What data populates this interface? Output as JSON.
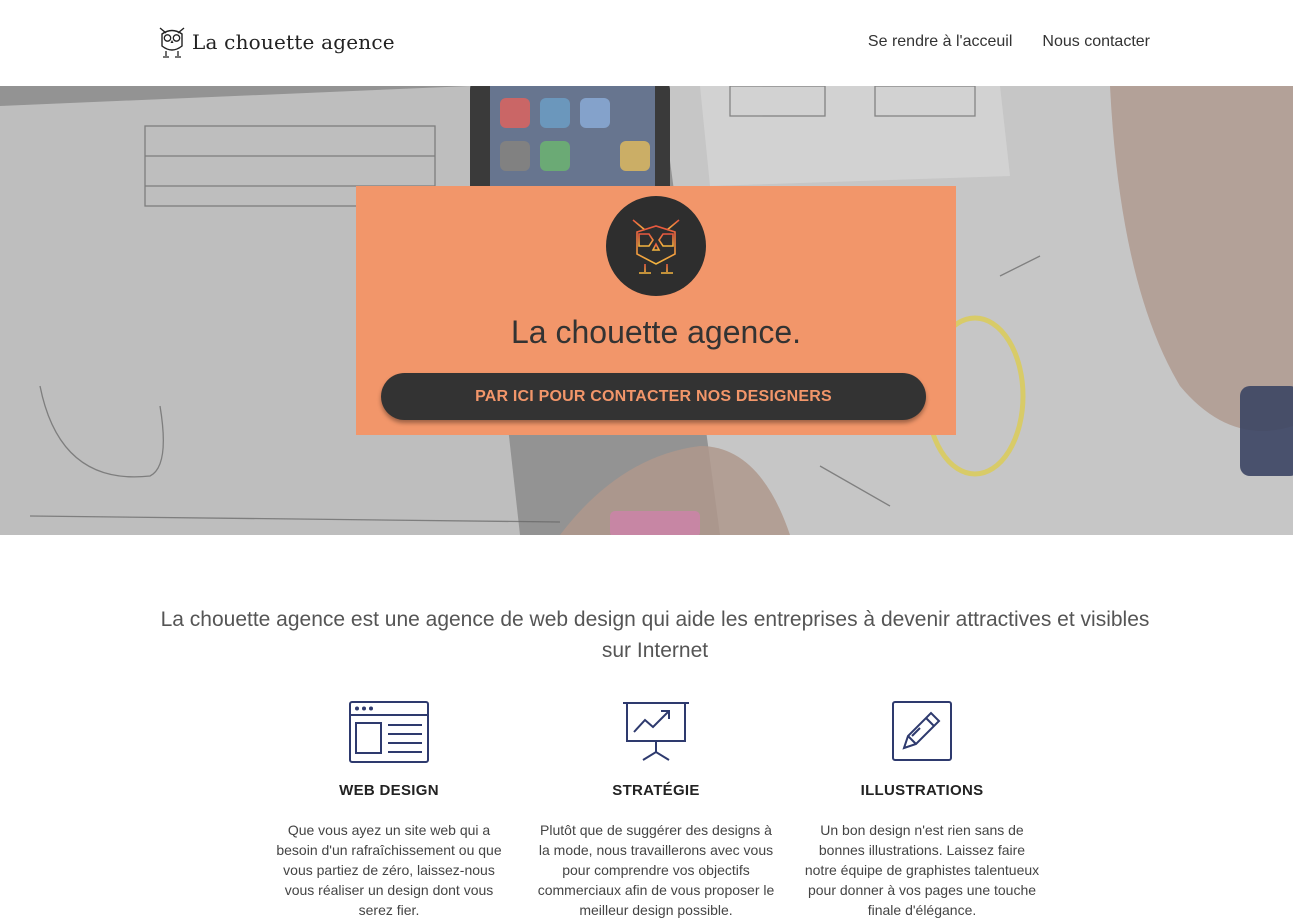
{
  "header": {
    "brand": "La chouette agence",
    "nav": [
      "Se rendre à l'acceuil",
      "Nous contacter"
    ]
  },
  "hero": {
    "title": "La chouette agence.",
    "cta": "PAR ICI POUR CONTACTER NOS DESIGNERS"
  },
  "tagline": "La chouette agence est une agence de web design qui aide les entreprises à devenir attractives et visibles sur Internet",
  "features": [
    {
      "icon": "web-design-icon",
      "title": "WEB DESIGN",
      "text": "Que vous ayez un site web qui a besoin d'un rafraîchissement ou que vous partiez de zéro, laissez-nous vous réaliser un design dont vous serez fier."
    },
    {
      "icon": "strategy-chart-icon",
      "title": "STRATÉGIE",
      "text": "Plutôt que de suggérer des designs à la mode, nous travaillerons avec vous pour comprendre vos objectifs commerciaux afin de vous proposer le meilleur design possible."
    },
    {
      "icon": "pencil-icon",
      "title": "ILLUSTRATIONS",
      "text": "Un bon design n'est rien sans de bonnes illustrations. Laissez faire notre équipe de graphistes talentueux pour donner à vos pages une touche finale d'élégance."
    }
  ],
  "colors": {
    "accent": "#f2966a",
    "dark": "#333333",
    "icon": "#2e3a6e"
  }
}
